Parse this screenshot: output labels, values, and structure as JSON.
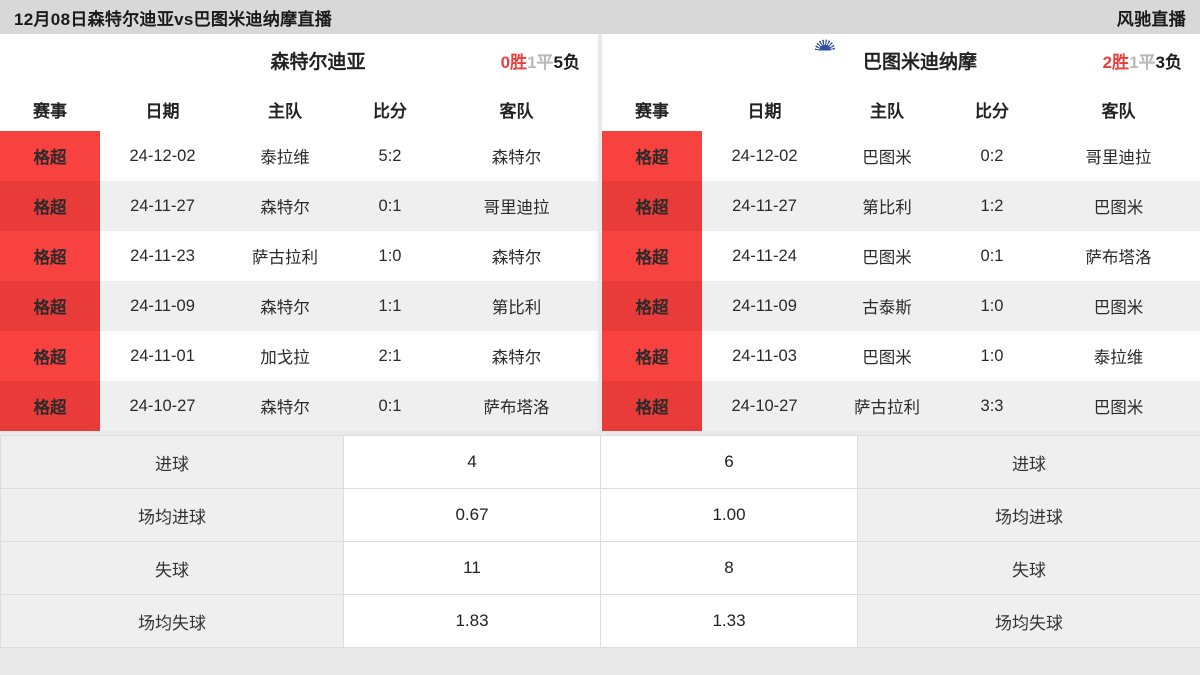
{
  "topbar": {
    "title": "12月08日森特尔迪亚vs巴图米迪纳摩直播",
    "brand": "风驰直播"
  },
  "colors": {
    "accent_red": "#f8423f",
    "accent_red_dark": "#e93c3a",
    "win": "#e8413c",
    "draw": "#b9b9b9",
    "loss": "#1d1d1d",
    "header_bg": "#d8d8d8",
    "row_alt": "#efefef"
  },
  "left_panel": {
    "team": {
      "name": "森特尔迪亚",
      "logo": "shield-logo",
      "record": {
        "wins": "0胜",
        "draws": "1平",
        "losses": "5负"
      }
    },
    "columns": [
      "赛事",
      "日期",
      "主队",
      "比分",
      "客队"
    ],
    "rows": [
      {
        "league": "格超",
        "date": "24-12-02",
        "home": "泰拉维",
        "score": "5:2",
        "away": "森特尔"
      },
      {
        "league": "格超",
        "date": "24-11-27",
        "home": "森特尔",
        "score": "0:1",
        "away": "哥里迪拉"
      },
      {
        "league": "格超",
        "date": "24-11-23",
        "home": "萨古拉利",
        "score": "1:0",
        "away": "森特尔"
      },
      {
        "league": "格超",
        "date": "24-11-09",
        "home": "森特尔",
        "score": "1:1",
        "away": "第比利"
      },
      {
        "league": "格超",
        "date": "24-11-01",
        "home": "加戈拉",
        "score": "2:1",
        "away": "森特尔"
      },
      {
        "league": "格超",
        "date": "24-10-27",
        "home": "森特尔",
        "score": "0:1",
        "away": "萨布塔洛"
      }
    ]
  },
  "right_panel": {
    "team": {
      "name": "巴图米迪纳摩",
      "logo": "roundel-logo",
      "record": {
        "wins": "2胜",
        "draws": "1平",
        "losses": "3负"
      }
    },
    "columns": [
      "赛事",
      "日期",
      "主队",
      "比分",
      "客队"
    ],
    "rows": [
      {
        "league": "格超",
        "date": "24-12-02",
        "home": "巴图米",
        "score": "0:2",
        "away": "哥里迪拉"
      },
      {
        "league": "格超",
        "date": "24-11-27",
        "home": "第比利",
        "score": "1:2",
        "away": "巴图米"
      },
      {
        "league": "格超",
        "date": "24-11-24",
        "home": "巴图米",
        "score": "0:1",
        "away": "萨布塔洛"
      },
      {
        "league": "格超",
        "date": "24-11-09",
        "home": "古泰斯",
        "score": "1:0",
        "away": "巴图米"
      },
      {
        "league": "格超",
        "date": "24-11-03",
        "home": "巴图米",
        "score": "1:0",
        "away": "泰拉维"
      },
      {
        "league": "格超",
        "date": "24-10-27",
        "home": "萨古拉利",
        "score": "3:3",
        "away": "巴图米"
      }
    ]
  },
  "stats": [
    {
      "left_label": "进球",
      "left_value": "4",
      "right_value": "6",
      "right_label": "进球"
    },
    {
      "left_label": "场均进球",
      "left_value": "0.67",
      "right_value": "1.00",
      "right_label": "场均进球"
    },
    {
      "left_label": "失球",
      "left_value": "11",
      "right_value": "8",
      "right_label": "失球"
    },
    {
      "left_label": "场均失球",
      "left_value": "1.83",
      "right_value": "1.33",
      "right_label": "场均失球"
    }
  ]
}
